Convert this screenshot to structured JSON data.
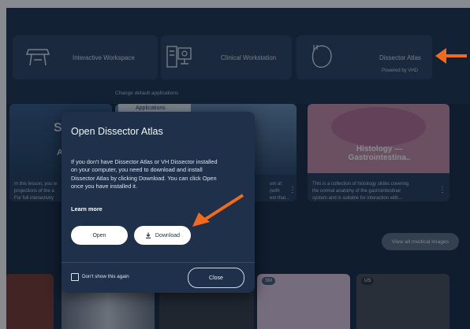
{
  "launchers": [
    {
      "label": "Interactive Workspace",
      "icon": "workspace-desk-icon"
    },
    {
      "label": "Clinical Workstation",
      "icon": "clinical-workstation-icon"
    },
    {
      "label": "Dissector Atlas",
      "sub": "Powered by VHD",
      "icon": "dissector-atlas-icon"
    }
  ],
  "change_defaults": "Change default applications",
  "applications_tab": "Applications",
  "cards": [
    {
      "overlay": "S",
      "sub": "A",
      "desc": [
        "In this lesson, you w",
        "projections of the a",
        "For full interactivity"
      ]
    },
    {
      "desc": [
        "um at",
        "(with",
        "em that..."
      ]
    },
    {
      "title": "Histology — Gastrointestina..",
      "desc": [
        "This is a collection of histology slides covering",
        "the normal anatomy of the gastrointestinal",
        "system and is suitable for interaction with..."
      ]
    }
  ],
  "view_all_label": "View all medical images",
  "thumb_tags": [
    "SM",
    "US"
  ],
  "modal": {
    "title": "Open Dissector Atlas",
    "body": [
      "If you don't have Dissector Atlas or VH Dissector installed",
      "on your computer, you need to download and install",
      "Dissector Atlas by clicking Download. You can click Open",
      "once you have installed it."
    ],
    "learn_more": "Learn more",
    "open_label": "Open",
    "download_label": "Download",
    "dont_show": "Don't show this again",
    "close_label": "Close"
  },
  "colors": {
    "background": "#1b2c43",
    "panel": "#2f4462",
    "modal": "#1f304a",
    "arrow": "#f26a1b"
  }
}
